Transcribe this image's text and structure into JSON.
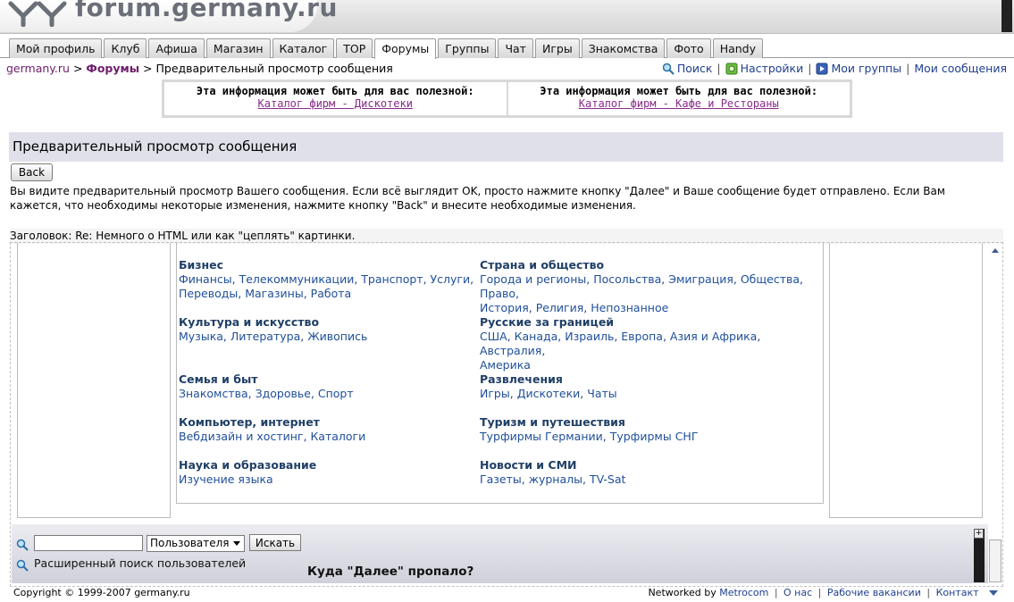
{
  "header": {
    "logo_text": "forum.germany.ru"
  },
  "tabs": [
    {
      "label": "Мой профиль"
    },
    {
      "label": "Клуб"
    },
    {
      "label": "Афиша"
    },
    {
      "label": "Магазин"
    },
    {
      "label": "Каталог"
    },
    {
      "label": "TOP"
    },
    {
      "label": "Форумы",
      "active": true
    },
    {
      "label": "Группы"
    },
    {
      "label": "Чат"
    },
    {
      "label": "Игры"
    },
    {
      "label": "Знакомства"
    },
    {
      "label": "Фото"
    },
    {
      "label": "Handy"
    }
  ],
  "breadcrumb": {
    "site": "germany.ru",
    "sep": ">",
    "forums": "Форумы",
    "current": "Предварительный просмотр сообщения"
  },
  "toplinks": {
    "search": "Поиск",
    "settings": "Настройки",
    "groups": "Мои группы",
    "messages": "Мои сообщения",
    "sep": "|"
  },
  "infobox": [
    {
      "title": "Эта информация может быть для вас полезной:",
      "link": "Каталог фирм - Дискотеки"
    },
    {
      "title": "Эта информация может быть для вас полезной:",
      "link": "Каталог фирм - Кафе и Рестораны"
    }
  ],
  "preview": {
    "title": "Предварительный просмотр сообщения",
    "back_label": "Back",
    "text": "Вы видите предварительный просмотр Вашего сообщения. Если всё выглядит OK, просто нажмите кнопку \"Далее\" и Ваше сообщение будет отправлено. Если Вам кажется, что необходимы некоторые изменения, нажмите кнопку \"Back\" и внесите необходимые изменения.",
    "subject": "Заголовок: Re: Немного о HTML или как \"цеплять\" картинки."
  },
  "categories": [
    {
      "title": "Бизнес",
      "links": [
        "Финансы",
        "Телекоммуникации",
        "Транспорт",
        "Услуги",
        "Переводы",
        "Магазины",
        "Работа"
      ]
    },
    {
      "title": "Страна и общество",
      "links": [
        "Города и регионы",
        "Посольства",
        "Эмиграция",
        "Общества",
        "Право",
        "История",
        "Религия",
        "Непознанное"
      ]
    },
    {
      "title": "Культура и искусство",
      "links": [
        "Музыка",
        "Литература",
        "Живопись"
      ]
    },
    {
      "title": "Русские за границей",
      "links": [
        "США",
        "Канада",
        "Израиль",
        "Европа",
        "Азия и Африка",
        "Австралия",
        "Америка"
      ]
    },
    {
      "title": "Семья и быт",
      "links": [
        "Знакомства",
        "Здоровье",
        "Спорт"
      ]
    },
    {
      "title": "Развлечения",
      "links": [
        "Игры",
        "Дискотеки",
        "Чаты"
      ]
    },
    {
      "title": "Компьютер, интернет",
      "links": [
        "Вебдизайн и хостинг",
        "Каталоги"
      ]
    },
    {
      "title": "Туризм и путешествия",
      "links": [
        "Турфирмы Германии",
        "Турфирмы СНГ"
      ]
    },
    {
      "title": "Наука и образование",
      "links": [
        "Изучение языка"
      ]
    },
    {
      "title": "Новости и СМИ",
      "links": [
        "Газеты, журналы",
        "TV-Sat"
      ]
    }
  ],
  "search": {
    "input_value": "",
    "select_value": "Пользователя",
    "button_label": "Искать",
    "advanced_label": "Расширенный поиск пользователей",
    "scroll_btn": "+"
  },
  "question": "Куда \"Далее\" пропало?",
  "footer": {
    "copyright": "Copyright © 1999-2007 germany.ru",
    "networked_by": "Networked by",
    "links": [
      "Metrocom",
      "О нас",
      "Рабочие вакансии",
      "Контакт"
    ]
  }
}
